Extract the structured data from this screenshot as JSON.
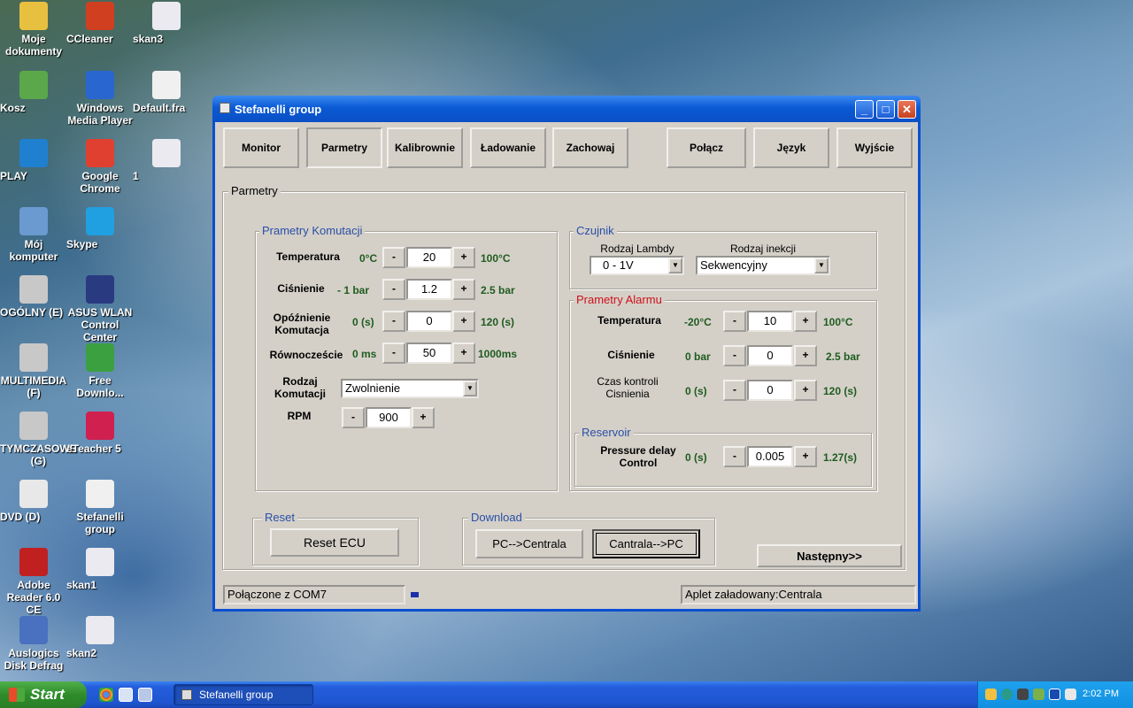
{
  "desktop": {
    "icons": [
      {
        "label": "Moje dokumenty"
      },
      {
        "label": "CCleaner"
      },
      {
        "label": "skan3"
      },
      {
        "label": "Kosz"
      },
      {
        "label": "Windows Media Player"
      },
      {
        "label": "Default.fra"
      },
      {
        "label": "PLAY"
      },
      {
        "label": "Google Chrome"
      },
      {
        "label": "1"
      },
      {
        "label": "Mój komputer"
      },
      {
        "label": "Skype"
      },
      {
        "label": "OGÓLNY (E)"
      },
      {
        "label": "ASUS WLAN Control Center"
      },
      {
        "label": "MULTIMEDIA (F)"
      },
      {
        "label": "Free Downlo..."
      },
      {
        "label": "TYMCZASOWE (G)"
      },
      {
        "label": "eTeacher 5"
      },
      {
        "label": "DVD (D)"
      },
      {
        "label": "Stefanelli group"
      },
      {
        "label": "Adobe Reader 6.0 CE"
      },
      {
        "label": "skan1"
      },
      {
        "label": "Auslogics Disk Defrag"
      },
      {
        "label": "skan2"
      }
    ]
  },
  "window": {
    "title": "Stefanelli group",
    "controls": {
      "minimize": "_",
      "maximize": "□",
      "close": "✕"
    },
    "toolbar": {
      "monitor": "Monitor",
      "parametry": "Parmetry",
      "kalibrownie": "Kalibrownie",
      "ladowanie": "Ładowanie",
      "zachowaj": "Zachowaj",
      "polacz": "Połącz",
      "jezyk": "Język",
      "wyjscie": "Wyjście"
    },
    "main_frame_title": "Parmetry",
    "komutacja": {
      "title": "Prametry Komutacji",
      "rows": [
        {
          "label": "Temperatura",
          "min": "0°C",
          "value": "20",
          "max": "100°C"
        },
        {
          "label": "Ciśnienie",
          "min": "- 1 bar",
          "value": "1.2",
          "max": "2.5 bar"
        },
        {
          "label": "Opóźnienie Komutacja",
          "min": "0 (s)",
          "value": "0",
          "max": "120 (s)"
        },
        {
          "label": "Równoczeście",
          "min": "0 ms",
          "value": "50",
          "max": "1000ms"
        }
      ],
      "rodzaj_label": "Rodzaj Komutacji",
      "rodzaj_value": "Zwolnienie",
      "rpm_label": "RPM",
      "rpm_value": "900",
      "minus": "-",
      "plus": "+"
    },
    "czujnik": {
      "title": "Czujnik",
      "lambda_label": "Rodzaj Lambdy",
      "lambda_value": "0 - 1V",
      "inekcja_label": "Rodzaj inekcji",
      "inekcja_value": "Sekwencyjny"
    },
    "alarm": {
      "title": "Prametry Alarmu",
      "rows": [
        {
          "label": "Temperatura",
          "min": "-20°C",
          "value": "10",
          "max": "100°C"
        },
        {
          "label": "Ciśnienie",
          "min": "0 bar",
          "value": "0",
          "max": "2.5 bar"
        },
        {
          "label": "Czas kontroli Cisnienia",
          "min": "0 (s)",
          "value": "0",
          "max": "120 (s)"
        }
      ]
    },
    "reservoir": {
      "title": "Reservoir",
      "label": "Pressure delay Control",
      "min": "0 (s)",
      "value": "0.005",
      "max": "1.27(s)"
    },
    "reset": {
      "title": "Reset",
      "button": "Reset ECU"
    },
    "download": {
      "title": "Download",
      "pc_to_centrala": "PC-->Centrala",
      "centrala_to_pc": "Cantrala-->PC"
    },
    "next_button": "Następny>>",
    "status": {
      "left": "Połączone z COM7",
      "right": "Aplet załadowany:Centrala"
    }
  },
  "taskbar": {
    "start": "Start",
    "task": "Stefanelli group",
    "clock": "2:02 PM"
  }
}
